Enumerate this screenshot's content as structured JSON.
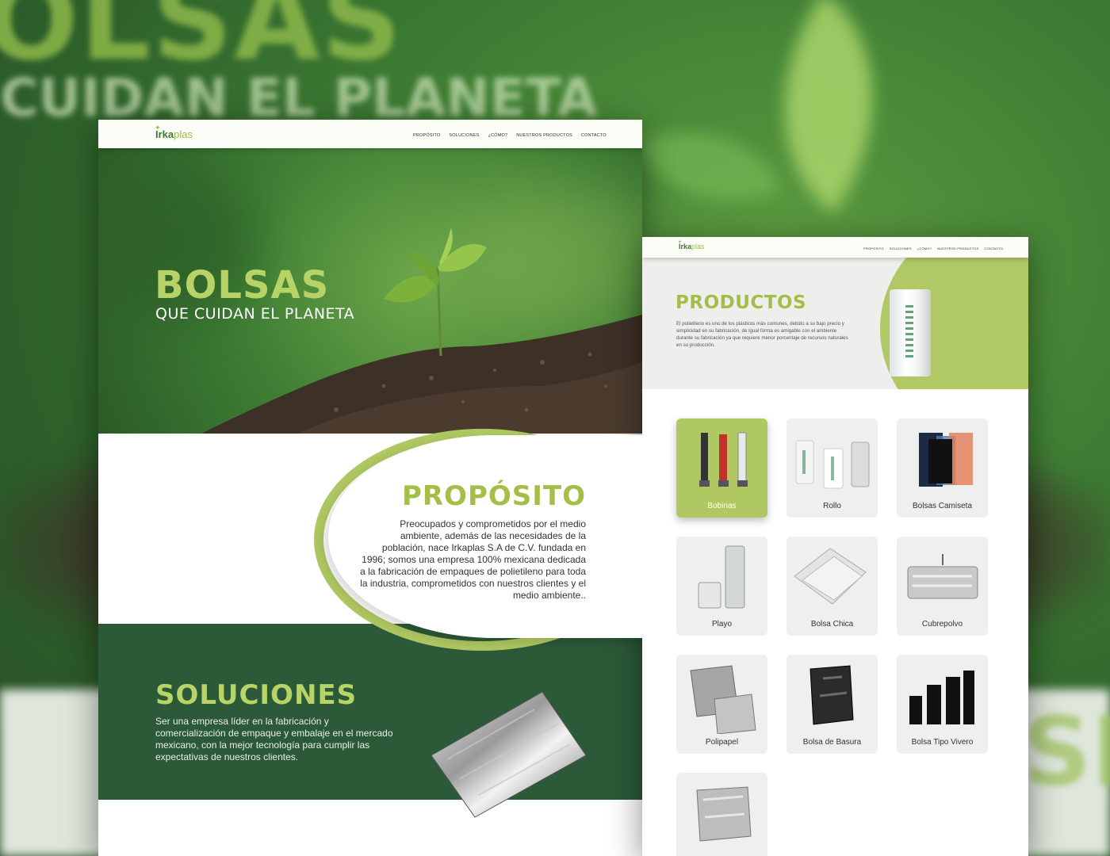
{
  "backdrop": {
    "headline_fragment": "OLSAS",
    "subheadline_fragment": "CUIDAN EL PLANETA",
    "right_fragment": "SIT"
  },
  "site": {
    "logo_irka": "Irka",
    "logo_plas": "plas",
    "nav": [
      "PROPÓSITO",
      "SOLUCIONES",
      "¿CÓMO?",
      "NUESTROS PRODUCTOS",
      "CONTACTO"
    ]
  },
  "home": {
    "hero_title": "BOLSAS",
    "hero_subtitle": "QUE CUIDAN EL PLANETA",
    "proposito_title": "PROPÓSITO",
    "proposito_text": "Preocupados y comprometidos por el medio ambiente, además de las necesidades de la población, nace Irkaplas S.A de C.V. fundada en 1996; somos una empresa 100% mexicana dedicada a la fabricación de empaques de polietileno para toda la industria, comprometidos con nuestros clientes y el medio ambiente..",
    "soluciones_title": "SOLUCIONES",
    "soluciones_text": "Ser una empresa líder en la fabricación y comercialización de empaque y embalaje en el mercado mexicano, con la mejor tecnología para cumplir las expectativas de nuestros clientes."
  },
  "products_page": {
    "title": "PRODUCTOS",
    "description": "El polietileno es uno de los plásticos más comunes, debido a su bajo precio y simplicidad en su fabricación, de igual forma es amigable con el ambiente durante su fabricación ya que requiere menor porcentaje de recursos naturales en su producción.",
    "products": [
      {
        "label": "Bobinas",
        "active": true
      },
      {
        "label": "Rollo",
        "active": false
      },
      {
        "label": "Bolsas Camiseta",
        "active": false
      },
      {
        "label": "Playo",
        "active": false
      },
      {
        "label": "Bolsa Chica",
        "active": false
      },
      {
        "label": "Cubrepolvo",
        "active": false
      },
      {
        "label": "Polipapel",
        "active": false
      },
      {
        "label": "Bolsa de Basura",
        "active": false
      },
      {
        "label": "Bolsa Tipo Vivero",
        "active": false
      },
      {
        "label": "",
        "active": false
      }
    ]
  },
  "colors": {
    "accent_green": "#afc862",
    "dark_green": "#2c5a38",
    "title_green": "#a4bf48"
  }
}
